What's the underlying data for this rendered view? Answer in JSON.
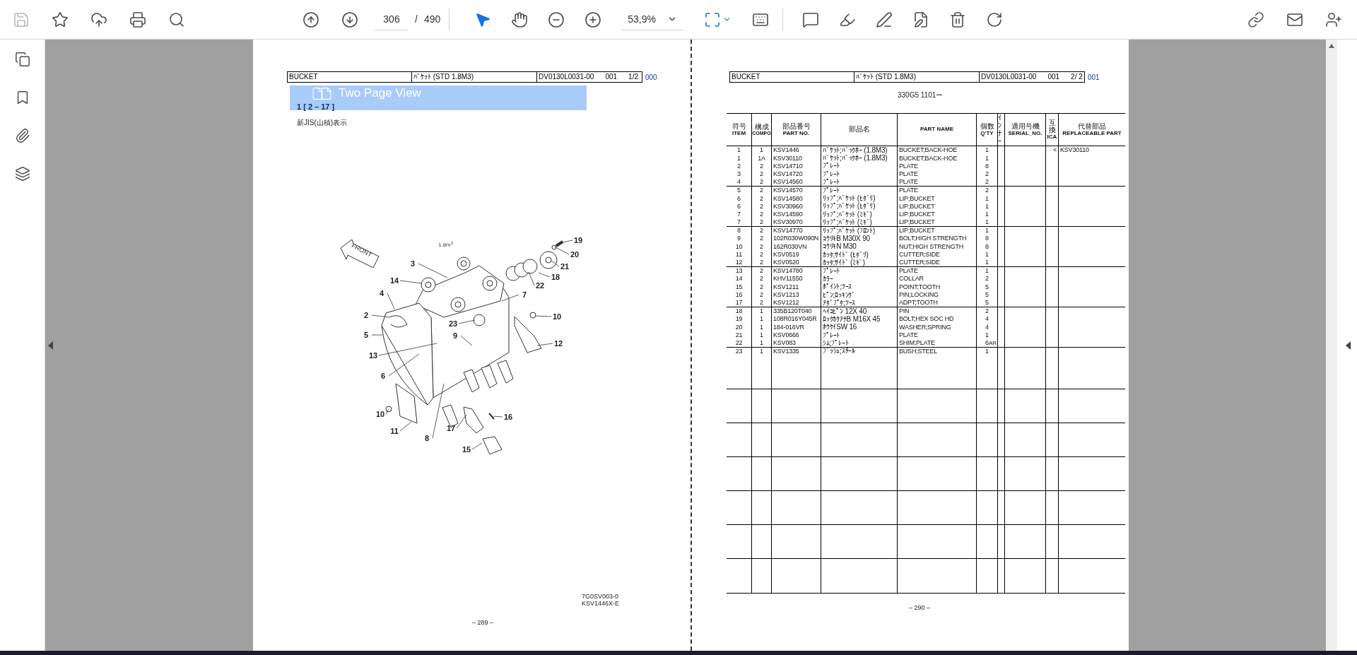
{
  "toolbar": {
    "save": {
      "disabled": true
    },
    "page_current": "306",
    "page_separator": "/",
    "page_total": "490",
    "tools": [
      {
        "kind": "select",
        "selected": true
      },
      {
        "kind": "hand",
        "selected": false
      }
    ],
    "zoom": "53,9%"
  },
  "tooltip": {
    "text": "Two Page View"
  },
  "left_page": {
    "header": [
      "BUCKET",
      "ﾊﾞｹｯﾄ (STD 1.8M3)",
      "DV0130L0031-00",
      "001",
      "1/2"
    ],
    "header_suffix": "000",
    "section": "1 [ 2 – 17 ]",
    "note": "新JIS(山積)表示",
    "diagram": {
      "capacity": "1.8m$^{3}$",
      "front_label": "FRONT",
      "callouts": [
        "19",
        "20",
        "21",
        "18",
        "22",
        "3",
        "14",
        "4",
        "7",
        "2",
        "10",
        "23",
        "5",
        "9",
        "12",
        "13",
        "6",
        "10",
        "16",
        "17",
        "11",
        "8",
        "15"
      ]
    },
    "drawing_codes": [
      "7G0SV003-0",
      "KSV1446X-E"
    ],
    "page_number": "– 289 –"
  },
  "right_page": {
    "header": [
      "BUCKET",
      "ﾊﾞｹｯﾄ (STD 1.8M3)",
      "DV0130L0031-00",
      "001",
      "2/ 2"
    ],
    "header_suffix": "001",
    "model": "330G5 1101ー",
    "table": {
      "columns": [
        {
          "kind": "stacked",
          "jp": "符号",
          "en": "ITEM"
        },
        {
          "kind": "stacked",
          "jp": "構成",
          "en": "COMPO"
        },
        {
          "kind": "stacked",
          "jp": "部品番号",
          "en": "PART NO."
        },
        {
          "kind": "stacked",
          "jp": "部品名"
        },
        {
          "kind": "stacked",
          "en": "PART  NAME"
        },
        {
          "kind": "stacked",
          "jp": "個数",
          "en": "Q'TY"
        },
        {
          "kind": "vertical",
          "jp": "ｲﾝﾅｰ"
        },
        {
          "kind": "stacked",
          "jp": "適用号機",
          "en": "SERIAL_NO."
        },
        {
          "kind": "stacked",
          "jp": "互換",
          "en": "ICA"
        },
        {
          "kind": "stacked",
          "jp": "代替部品",
          "en": "REPLACEABLE PART"
        }
      ],
      "rows": [
        {
          "item": "1",
          "compo": "1",
          "part_no": "KSV1446",
          "name_jp": "ﾊﾞｹｯﾄ;ﾊﾞｯｸﾎｰ (1.8M3)",
          "part_name": "BUCKET;BACK-HOE",
          "qty": "1",
          "ica": "<",
          "replaceable": "KSV30110"
        },
        {
          "item": "1",
          "compo": "1A",
          "part_no": "KSV30110",
          "name_jp": "ﾊﾞｹｯﾄ;ﾊﾞｯｸﾎｰ (1.8M3)",
          "part_name": "BUCKET;BACK-HOE",
          "qty": "1"
        },
        {
          "item": "2",
          "compo": "2",
          "part_no": "KSV14710",
          "name_jp": "ﾌﾟﾚｰﾄ",
          "part_name": "PLATE",
          "qty": "8"
        },
        {
          "item": "3",
          "compo": "2",
          "part_no": "KSV14720",
          "name_jp": "ﾌﾟﾚｰﾄ",
          "part_name": "PLATE",
          "qty": "2"
        },
        {
          "item": "4",
          "compo": "2",
          "part_no": "KSV14560",
          "name_jp": "ﾌﾟﾚｰﾄ",
          "part_name": "PLATE",
          "qty": "2"
        },
        {
          "item": "5",
          "compo": "2",
          "part_no": "KSV14570",
          "name_jp": "ﾌﾟﾚｰﾄ",
          "part_name": "PLATE",
          "qty": "2"
        },
        {
          "item": "6",
          "compo": "2",
          "part_no": "KSV14580",
          "name_jp": "ﾘｯﾌﾟ;ﾊﾞｹｯﾄ (ﾋﾀﾞﾘ)",
          "part_name": "LIP;BUCKET",
          "qty": "1"
        },
        {
          "item": "6",
          "compo": "2",
          "part_no": "KSV30960",
          "name_jp": "ﾘｯﾌﾟ;ﾊﾞｹｯﾄ (ﾋﾀﾞﾘ)",
          "part_name": "LIP;BUCKET",
          "qty": "1"
        },
        {
          "item": "7",
          "compo": "2",
          "part_no": "KSV14590",
          "name_jp": "ﾘｯﾌﾟ;ﾊﾞｹｯﾄ (ﾐｷﾞ)",
          "part_name": "LIP;BUCKET",
          "qty": "1"
        },
        {
          "item": "7",
          "compo": "2",
          "part_no": "KSV30970",
          "name_jp": "ﾘｯﾌﾟ;ﾊﾞｹｯﾄ (ﾐｷﾞ)",
          "part_name": "LIP;BUCKET",
          "qty": "1"
        },
        {
          "item": "8",
          "compo": "2",
          "part_no": "KSV14770",
          "name_jp": "ﾘｯﾌﾟ;ﾊﾞｹｯﾄ (ﾌﾛﾝﾄ)",
          "part_name": "LIP;BUCKET",
          "qty": "1"
        },
        {
          "item": "9",
          "compo": "2",
          "part_no": "102R030W090N",
          "name_jp": "ｺｳﾘｷB M30X 90",
          "part_name": "BOLT;HIGH STRENGTH",
          "qty": "8"
        },
        {
          "item": "10",
          "compo": "2",
          "part_no": "162R030VN",
          "name_jp": "ｺｳﾘｷN M30",
          "part_name": "NUT;HIGH STRENGTH",
          "qty": "8"
        },
        {
          "item": "11",
          "compo": "2",
          "part_no": "KSV0519",
          "name_jp": "ｶｯﾀ;ｻｲﾄﾞ (ﾋﾀﾞﾘ)",
          "part_name": "CUTTER;SIDE",
          "qty": "1"
        },
        {
          "item": "12",
          "compo": "2",
          "part_no": "KSV0520",
          "name_jp": "ｶｯﾀ;ｻｲﾄﾞ (ﾐｷﾞ)",
          "part_name": "CUTTER;SIDE",
          "qty": "1"
        },
        {
          "item": "13",
          "compo": "2",
          "part_no": "KSV14780",
          "name_jp": "ﾌﾟﾚｰﾄ",
          "part_name": "PLATE",
          "qty": "1"
        },
        {
          "item": "14",
          "compo": "2",
          "part_no": "KHV11550",
          "name_jp": "ｶﾗｰ",
          "part_name": "COLLAR",
          "qty": "2"
        },
        {
          "item": "15",
          "compo": "2",
          "part_no": "KSV1211",
          "name_jp": "ﾎﾟｲﾝﾄ;ﾂｰｽ",
          "part_name": "POINT;TOOTH",
          "qty": "5"
        },
        {
          "item": "16",
          "compo": "2",
          "part_no": "KSV1213",
          "name_jp": "ﾋﾟﾝ;ﾛｯｷﾝｸﾞ",
          "part_name": "PIN;LOCKING",
          "qty": "5"
        },
        {
          "item": "17",
          "compo": "2",
          "part_no": "KSV1212",
          "name_jp": "ｱﾀﾞﾌﾟﾀ;ﾂｰｽ",
          "part_name": "ADPT;TOOTH",
          "qty": "5"
        },
        {
          "item": "18",
          "compo": "1",
          "part_no": "335B120T040",
          "name_jp": "ﾍｲｺﾋﾟﾝ 12X 40",
          "part_name": "PIN",
          "qty": "2"
        },
        {
          "item": "19",
          "compo": "1",
          "part_no": "108R016Y045R",
          "name_jp": "ﾛｯｸｶｸｱﾅB M16X 45",
          "part_name": "BOLT;HEX SOC HD",
          "qty": "4"
        },
        {
          "item": "20",
          "compo": "1",
          "part_no": "184-016VR",
          "name_jp": "ﾎｳｹｲSW 16",
          "part_name": "WASHER;SPRING",
          "qty": "4"
        },
        {
          "item": "21",
          "compo": "1",
          "part_no": "KSV0666",
          "name_jp": "ﾌﾟﾚｰﾄ",
          "part_name": "PLATE",
          "qty": "1"
        },
        {
          "item": "22",
          "compo": "1",
          "part_no": "KSV083",
          "name_jp": "ｼﾑ;ﾌﾟﾚｰﾄ",
          "part_name": "SHIM;PLATE",
          "qty": "6",
          "remark": "AR"
        },
        {
          "item": "23",
          "compo": "1",
          "part_no": "KSV1335",
          "name_jp": "ﾌﾞｯｼｭ;ｽﾁｰﾙ",
          "part_name": "BUSH;STEEL",
          "qty": "1"
        }
      ]
    },
    "page_number": "– 290 –"
  }
}
